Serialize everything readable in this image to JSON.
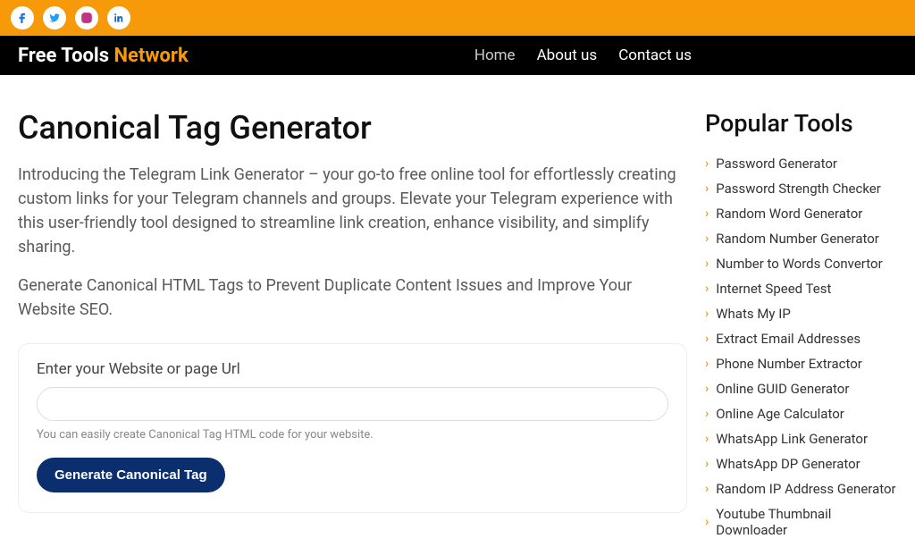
{
  "brand": {
    "word1": "Free Tools",
    "word2": " Network"
  },
  "nav": {
    "items": [
      {
        "label": "Home"
      },
      {
        "label": "About us"
      },
      {
        "label": "Contact us"
      }
    ]
  },
  "main": {
    "title": "Canonical Tag Generator",
    "intro": "Introducing the Telegram Link Generator – your go-to free online tool for effortlessly creating custom links for your Telegram channels and groups. Elevate your Telegram experience with this user-friendly tool designed to streamline link creation, enhance visibility, and simplify sharing.",
    "sub": "Generate Canonical HTML Tags to Prevent Duplicate Content Issues and Improve Your Website SEO.",
    "form": {
      "label": "Enter your Website or page Url",
      "value": "",
      "help": "You can easily create Canonical Tag HTML code for your website.",
      "button": "Generate Canonical Tag"
    }
  },
  "sidebar": {
    "title": "Popular Tools",
    "tools": [
      "Password Generator",
      "Password Strength Checker",
      "Random Word Generator",
      "Random Number Generator",
      "Number to Words Convertor",
      "Internet Speed Test",
      "Whats My IP",
      "Extract Email Addresses",
      "Phone Number Extractor",
      "Online GUID Generator",
      "Online Age Calculator",
      "WhatsApp Link Generator",
      "WhatsApp DP Generator",
      "Random IP Address Generator",
      "Youtube Thumbnail Downloader"
    ]
  }
}
